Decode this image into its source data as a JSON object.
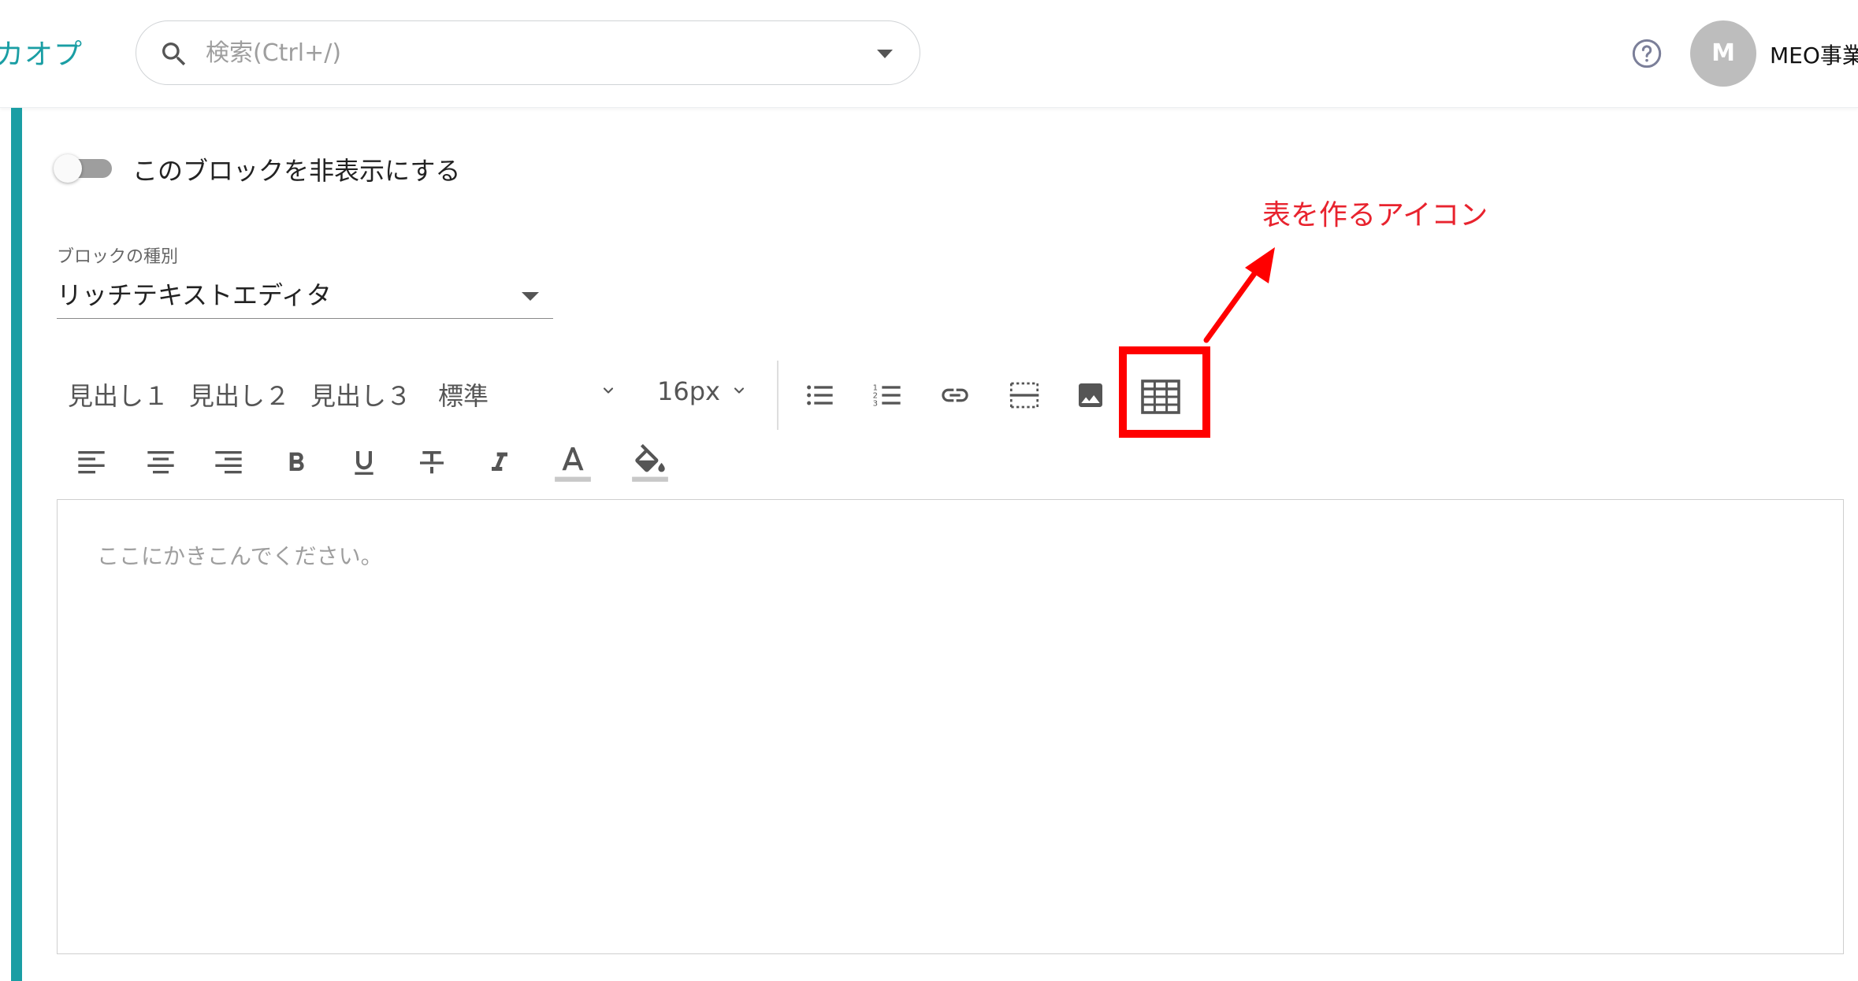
{
  "header": {
    "brand_text": "カオプ",
    "search_placeholder": "検索(Ctrl+/)",
    "help_icon": "help-circle-icon",
    "avatar_initial": "M",
    "user_name": "MEO事業"
  },
  "block": {
    "hide_toggle_label": "このブロックを非表示にする",
    "hide_toggle_on": false,
    "type_label": "ブロックの種別",
    "type_value": "リッチテキストエディタ"
  },
  "toolbar": {
    "heading1": "見出し１",
    "heading2": "見出し２",
    "heading3": "見出し３",
    "paragraph_style": "標準",
    "font_size": "16px",
    "row1_icons": [
      "bulleted-list-icon",
      "numbered-list-icon",
      "link-icon",
      "page-break-icon",
      "image-icon",
      "table-icon"
    ],
    "row2_icons": [
      "align-left-icon",
      "align-center-icon",
      "align-right-icon",
      "bold-icon",
      "underline-icon",
      "strikethrough-icon",
      "italic-icon",
      "text-color-icon",
      "background-color-icon"
    ]
  },
  "editor": {
    "placeholder": "ここにかきこんでください。"
  },
  "annotation": {
    "text": "表を作るアイコン",
    "color": "#e8232e"
  },
  "colors": {
    "accent": "#1a9ea4",
    "annotation_red": "#ff0000"
  }
}
